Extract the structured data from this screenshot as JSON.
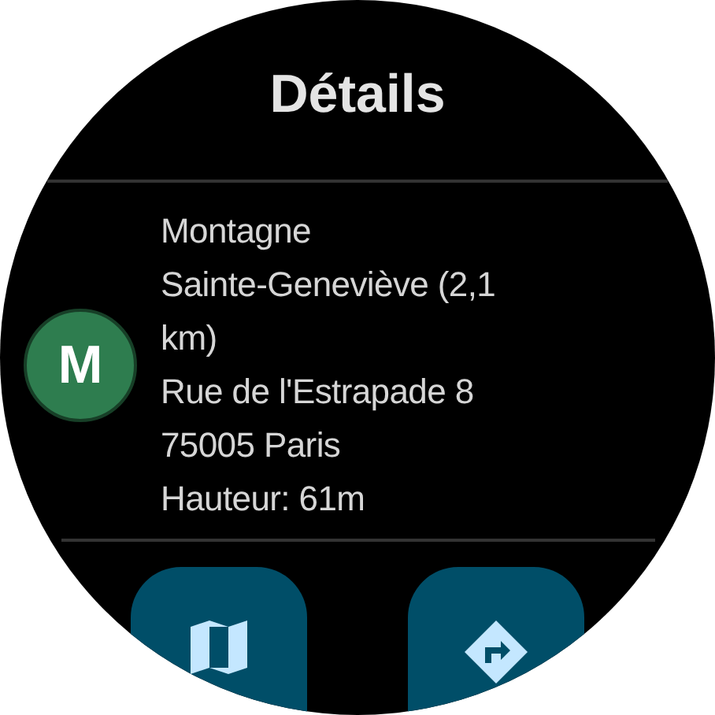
{
  "title": "Détails",
  "badge": {
    "letter": "M",
    "color": "#2e7d4f"
  },
  "lines": [
    "Montagne",
    "Sainte-Geneviève (2,1",
    "km)",
    "Rue de l'Estrapade 8",
    "75005 Paris",
    "Hauteur: 61m"
  ],
  "actions": [
    {
      "kind": "map"
    },
    {
      "kind": "directions"
    }
  ]
}
